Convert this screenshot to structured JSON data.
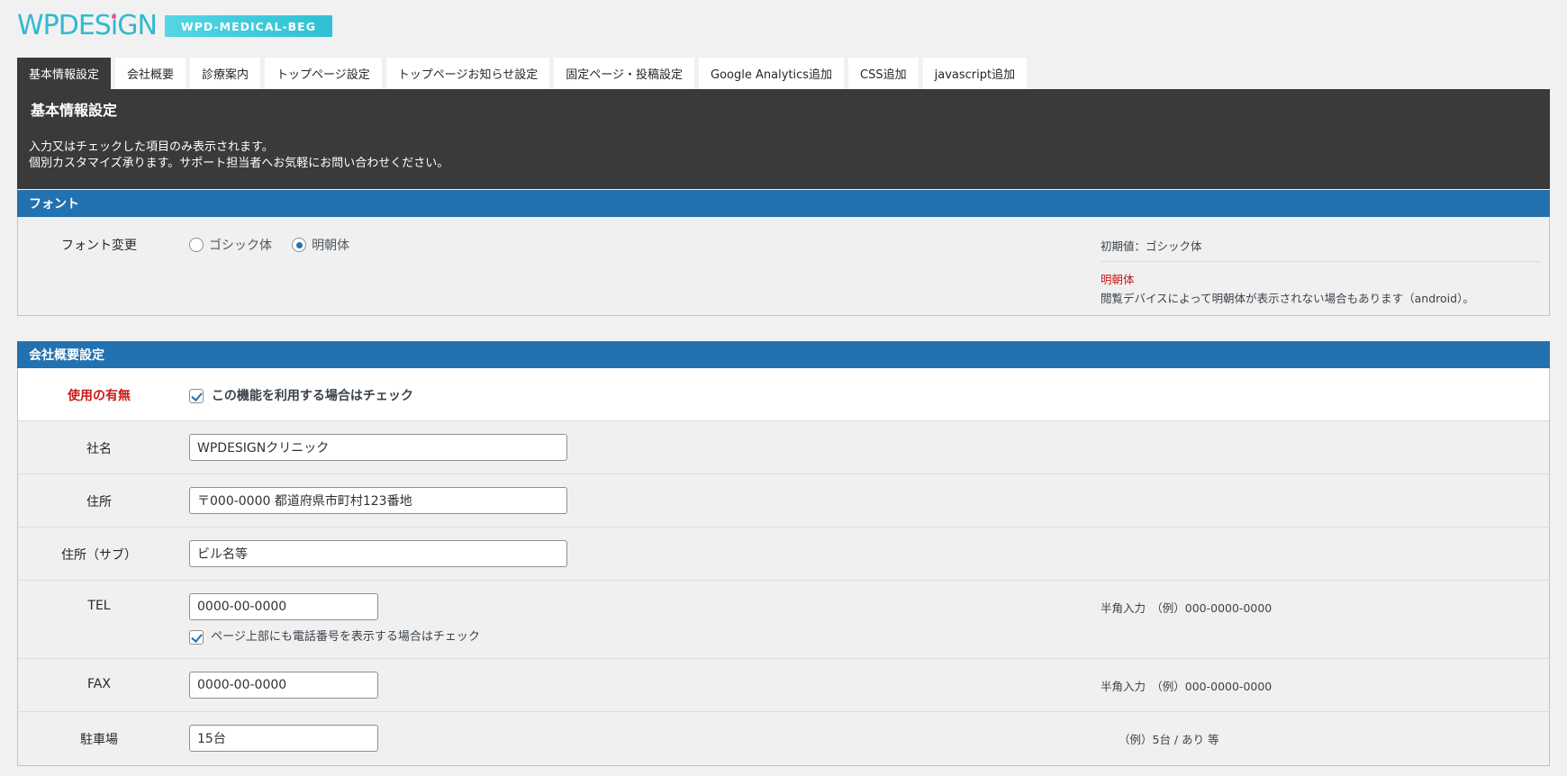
{
  "logo": {
    "text_a": "WPDES",
    "text_i": "i",
    "text_b": "GN",
    "badge": "WPD-MEDICAL-BEG"
  },
  "tabs": [
    {
      "label": "基本情報設定",
      "active": true
    },
    {
      "label": "会社概要"
    },
    {
      "label": "診療案内"
    },
    {
      "label": "トップページ設定"
    },
    {
      "label": "トップページお知らせ設定"
    },
    {
      "label": "固定ページ・投稿設定"
    },
    {
      "label": "Google Analytics追加"
    },
    {
      "label": "CSS追加"
    },
    {
      "label": "javascript追加"
    }
  ],
  "intro": {
    "title": "基本情報設定",
    "line1": "入力又はチェックした項目のみ表示されます。",
    "line2": "個別カスタマイズ承ります。サポート担当者へお気軽にお問い合わせください。"
  },
  "font_section": {
    "title": "フォント",
    "label": "フォント変更",
    "options": [
      {
        "label": "ゴシック体",
        "selected": false
      },
      {
        "label": "明朝体",
        "selected": true
      }
    ],
    "default_note": "初期値：ゴシック体",
    "warn_title": "明朝体",
    "warn_text": "閲覧デバイスによって明朝体が表示されない場合もあります（android）。"
  },
  "company_section": {
    "title": "会社概要設定",
    "use": {
      "label": "使用の有無",
      "checkbox_label": "この機能を利用する場合はチェック",
      "checked": true
    },
    "name": {
      "label": "社名",
      "value": "WPDESIGNクリニック"
    },
    "address": {
      "label": "住所",
      "value": "〒000-0000 都道府県市町村123番地"
    },
    "address_sub": {
      "label": "住所（サブ）",
      "value": "ビル名等"
    },
    "tel": {
      "label": "TEL",
      "value": "0000-00-0000",
      "checkbox_label": "ページ上部にも電話番号を表示する場合はチェック",
      "checked": true,
      "note": "半角入力　（例）000-0000-0000"
    },
    "fax": {
      "label": "FAX",
      "value": "0000-00-0000",
      "note": "半角入力　（例）000-0000-0000"
    },
    "parking": {
      "label": "駐車場",
      "value": "15台",
      "note": "（例）5台 / あり 等"
    }
  },
  "colors": {
    "accent": "#2271b1",
    "dark": "#3a3a3a",
    "logo": "#32b9ce",
    "required": "#cc1818"
  }
}
